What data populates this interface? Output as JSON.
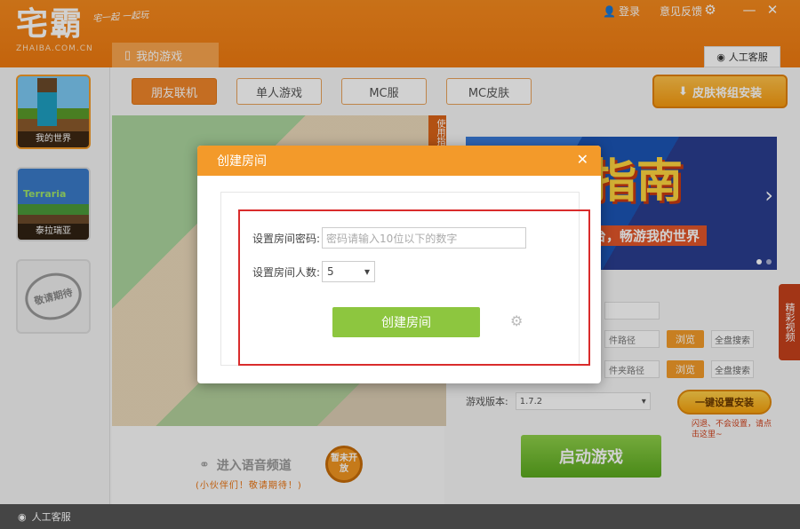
{
  "app": {
    "logo": "宅霸",
    "logo_sub": "ZHAIBA.COM.CN",
    "slogan": "宅一起 一起玩"
  },
  "top_links": {
    "login": "登录",
    "feedback": "意见反馈"
  },
  "tabs": {
    "my_games": "我的游戏"
  },
  "support_label": "人工客服",
  "sidebar": {
    "items": [
      {
        "label": "我的世界"
      },
      {
        "label": "泰拉瑞亚",
        "art_title": "Terraria"
      },
      {
        "label": "敬请期待"
      }
    ]
  },
  "subtabs": [
    {
      "label": "朋友联机",
      "active": true
    },
    {
      "label": "单人游戏",
      "active": false
    },
    {
      "label": "MC服",
      "active": false
    },
    {
      "label": "MC皮肤",
      "active": false
    }
  ],
  "skin_button": "皮肤将组安装",
  "side_tab": "使用指",
  "banner": {
    "title": "指南",
    "subtitle": "平台，畅游我的世界"
  },
  "side_promo": "精彩视频",
  "form": {
    "path1_hint": "件路径",
    "path2_hint": "件夹路径",
    "browse_label": "浏览",
    "search_label": "全盘搜索",
    "version_label": "游戏版本:",
    "version_value": "1.7.2"
  },
  "install_button": "一键设置安装",
  "install_tip": "闪退、不会设置，请点击这里~",
  "start_button": "启动游戏",
  "voice": {
    "title": "进入语音频道",
    "subtitle": "(小伙伴们！敬请期待！)",
    "badge": "暂未开放"
  },
  "footer_label": "人工客服",
  "modal": {
    "title": "创建房间",
    "password_label": "设置房间密码:",
    "password_placeholder": "密码请输入10位以下的数字",
    "count_label": "设置房间人数:",
    "count_value": "5",
    "create_button": "创建房间"
  },
  "colors": {
    "accent": "#f39a2a",
    "header": "#f58a1e",
    "highlight": "#d92c2c",
    "create_button": "#8dc63f"
  }
}
